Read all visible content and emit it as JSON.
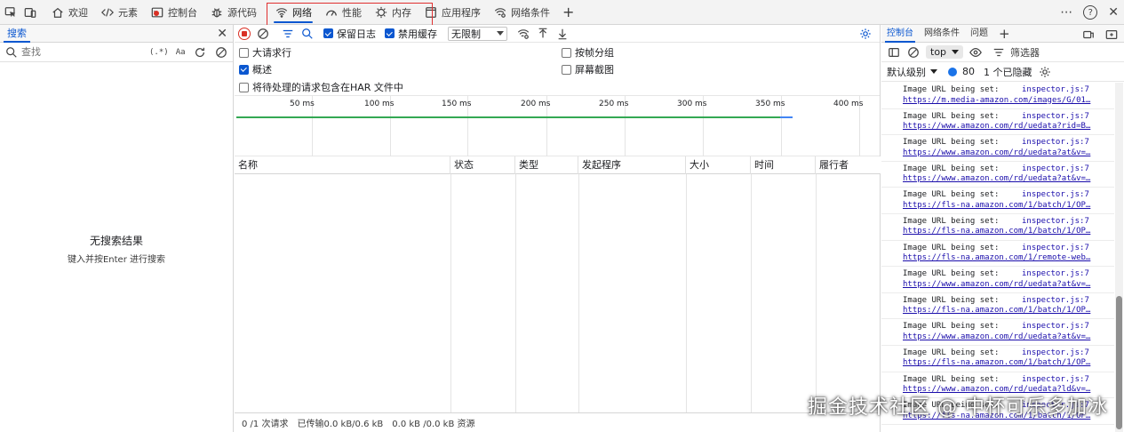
{
  "topbar": {
    "tabs": [
      {
        "label": "欢迎",
        "icon": "home-icon"
      },
      {
        "label": "元素",
        "icon": "code-icon"
      },
      {
        "label": "控制台",
        "icon": "console-icon"
      },
      {
        "label": "源代码",
        "icon": "bug-icon"
      },
      {
        "label": "网络",
        "icon": "wifi-icon",
        "active": true
      },
      {
        "label": "性能",
        "icon": "gauge-icon"
      },
      {
        "label": "内存",
        "icon": "memory-icon"
      },
      {
        "label": "应用程序",
        "icon": "window-icon"
      },
      {
        "label": "网络条件",
        "icon": "wifi-settings-icon"
      }
    ],
    "add_tab": "+",
    "more": "⋯",
    "help": "?",
    "close": "✕"
  },
  "left_panel": {
    "tab": "搜索",
    "search_placeholder": "查找",
    "regex_label": "(.*)",
    "case_label": "Aa",
    "empty_title": "无搜索结果",
    "empty_hint": "键入并按Enter 进行搜索"
  },
  "network": {
    "preserve_log": "保留日志",
    "disable_cache": "禁用缓存",
    "throttle": "无限制",
    "options": {
      "big_rows": "大请求行",
      "group_by_frame": "按帧分组",
      "overview": "概述",
      "screenshots": "屏幕截图",
      "har_pending": "将待处理的请求包含在HAR 文件中"
    },
    "timeline_ticks": [
      "50 ms",
      "100 ms",
      "150 ms",
      "200 ms",
      "250 ms",
      "300 ms",
      "350 ms",
      "400 ms"
    ],
    "columns": [
      "名称",
      "状态",
      "类型",
      "发起程序",
      "大小",
      "时间",
      "履行者"
    ],
    "status": {
      "requests": "0 /1 次请求",
      "transferred": "已传输0.0 kB/0.6 kB",
      "resources": "0.0 kB /0.0 kB 资源"
    }
  },
  "console": {
    "tabs": [
      "控制台",
      "网络条件",
      "问题"
    ],
    "context": "top",
    "filter_label": "筛选器",
    "level_label": "默认级别",
    "message_count": "80",
    "hidden_label": "1 个已隐藏",
    "logs": [
      {
        "msg": "Image URL being set:",
        "src": "inspector.js:7",
        "url": "https://m.media-amazon.com/images/G/01…"
      },
      {
        "msg": "Image URL being set:",
        "src": "inspector.js:7",
        "url": "https://www.amazon.com/rd/uedata?rid=B…"
      },
      {
        "msg": "Image URL being set:",
        "src": "inspector.js:7",
        "url": "https://www.amazon.com/rd/uedata?at&v=…"
      },
      {
        "msg": "Image URL being set:",
        "src": "inspector.js:7",
        "url": "https://www.amazon.com/rd/uedata?at&v=…"
      },
      {
        "msg": "Image URL being set:",
        "src": "inspector.js:7",
        "url": "https://fls-na.amazon.com/1/batch/1/OP…"
      },
      {
        "msg": "Image URL being set:",
        "src": "inspector.js:7",
        "url": "https://fls-na.amazon.com/1/batch/1/OP…"
      },
      {
        "msg": "Image URL being set:",
        "src": "inspector.js:7",
        "url": "https://fls-na.amazon.com/1/remote-web…"
      },
      {
        "msg": "Image URL being set:",
        "src": "inspector.js:7",
        "url": "https://www.amazon.com/rd/uedata?at&v=…"
      },
      {
        "msg": "Image URL being set:",
        "src": "inspector.js:7",
        "url": "https://fls-na.amazon.com/1/batch/1/OP…"
      },
      {
        "msg": "Image URL being set:",
        "src": "inspector.js:7",
        "url": "https://www.amazon.com/rd/uedata?at&v=…"
      },
      {
        "msg": "Image URL being set:",
        "src": "inspector.js:7",
        "url": "https://fls-na.amazon.com/1/batch/1/OP…"
      },
      {
        "msg": "Image URL being set:",
        "src": "inspector.js:7",
        "url": "https://www.amazon.com/rd/uedata?ld&v=…"
      },
      {
        "msg": "Image URL being set:",
        "src": "inspector.js:7",
        "url": "https://fls-na.amazon.com/1/batch/1/OP…"
      }
    ]
  },
  "watermark": "掘金技术社区 @ 中杯可乐多加冰",
  "colors": {
    "accent": "#0b57d0",
    "record": "#d93025",
    "highlight_box": "#e03030",
    "timeline_green": "#34a853"
  }
}
